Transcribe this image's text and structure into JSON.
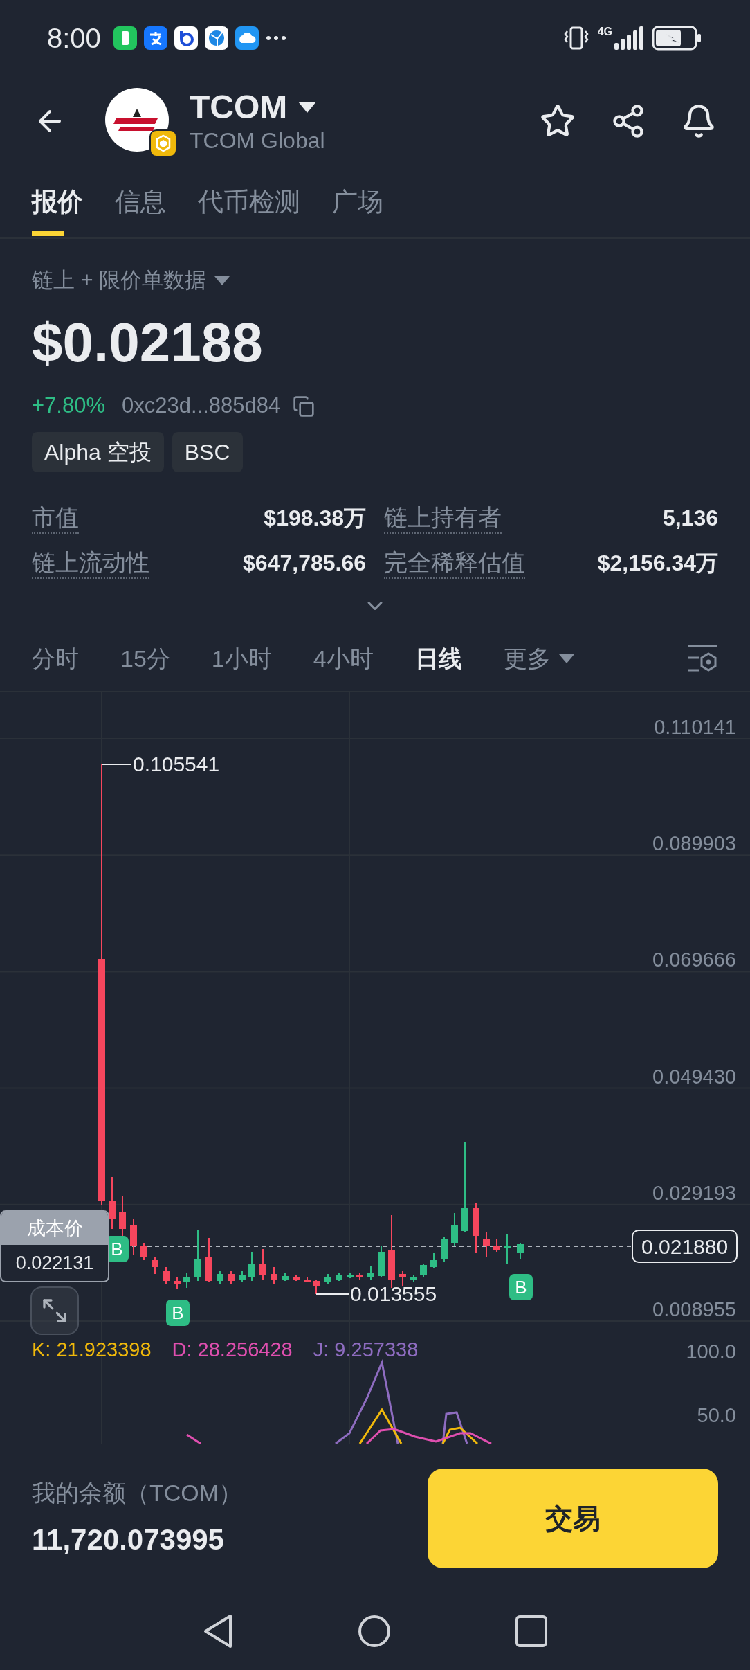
{
  "status_bar": {
    "time": "8:00",
    "network": "4G"
  },
  "header": {
    "symbol": "TCOM",
    "name": "TCOM Global"
  },
  "tabs": [
    {
      "label": "报价",
      "selected": true
    },
    {
      "label": "信息",
      "selected": false
    },
    {
      "label": "代币检测",
      "selected": false
    },
    {
      "label": "广场",
      "selected": false
    }
  ],
  "data_source": "链上 + 限价单数据",
  "price": "$0.02188",
  "change": "+7.80%",
  "contract": "0xc23d...885d84",
  "tags": [
    "Alpha 空投",
    "BSC"
  ],
  "stats": [
    {
      "label": "市值",
      "value": "$198.38万"
    },
    {
      "label": "链上持有者",
      "value": "5,136"
    },
    {
      "label": "链上流动性",
      "value": "$647,785.66"
    },
    {
      "label": "完全稀释估值",
      "value": "$2,156.34万"
    }
  ],
  "timeframes": [
    {
      "label": "分时",
      "selected": false
    },
    {
      "label": "15分",
      "selected": false
    },
    {
      "label": "1小时",
      "selected": false
    },
    {
      "label": "4小时",
      "selected": false
    },
    {
      "label": "日线",
      "selected": true
    },
    {
      "label": "更多",
      "selected": false,
      "kind": "dropdown"
    }
  ],
  "chart": {
    "y_labels": [
      "0.110141",
      "0.089903",
      "0.069666",
      "0.049430",
      "0.029193",
      "0.008955"
    ],
    "high_label": "0.105541",
    "low_label": "0.013555",
    "current_price": "0.021880",
    "cost_price": {
      "label": "成本价",
      "value": "0.022131"
    },
    "markers": [
      "B",
      "B",
      "B"
    ],
    "kdj": [
      {
        "text": "K: 21.923398",
        "color": "#f0b90b"
      },
      {
        "text": "D: 28.256428",
        "color": "#e04fb0"
      },
      {
        "text": "J: 9.257338",
        "color": "#8e6cc0"
      }
    ],
    "kdj_axis": [
      "100.0",
      "50.0"
    ]
  },
  "balance": {
    "label": "我的余额（TCOM）",
    "value": "11,720.073995"
  },
  "trade_button": "交易"
}
